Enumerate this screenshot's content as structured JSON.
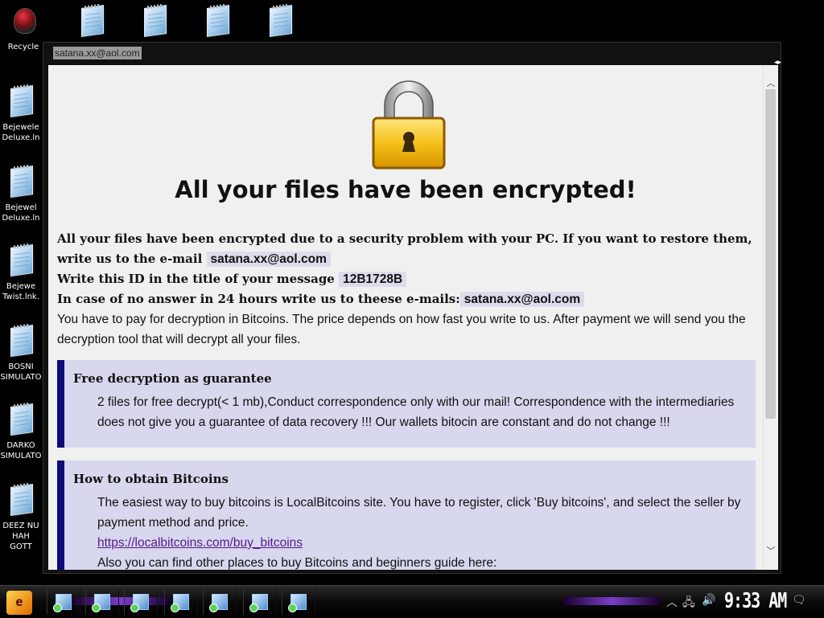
{
  "desktop": {
    "icons": [
      {
        "label": "Recycle",
        "icon": "recycle-bin-icon"
      },
      {
        "label": "",
        "icon": "notepad-icon"
      },
      {
        "label": "",
        "icon": "notepad-icon"
      },
      {
        "label": "",
        "icon": "notepad-icon"
      },
      {
        "label": "",
        "icon": "notepad-icon"
      },
      {
        "label": "Bejewele Deluxe.ln",
        "icon": "notepad-icon"
      },
      {
        "label": "Bejewel Deluxe.ln",
        "icon": "notepad-icon"
      },
      {
        "label": "Bejewe Twist.lnk.",
        "icon": "notepad-icon"
      },
      {
        "label": "BOSNI SIMULATO",
        "icon": "notepad-icon"
      },
      {
        "label": "DARKO SIMULATO",
        "icon": "notepad-icon"
      },
      {
        "label": "DEEZ NU HAH GOTT",
        "icon": "notepad-icon"
      }
    ]
  },
  "window": {
    "title": "satana.xx@aol.com",
    "headline": "All your files have been encrypted!",
    "line1_text": "All your files have been encrypted due to a security problem with your PC. If you want to restore them, write us to the e-mail",
    "email": "satana.xx@aol.com",
    "line2_text": "Write this ID in the title of your message",
    "id_code": "12B1728B",
    "line3_text": "In case of no answer in 24 hours write us to theese e-mails:",
    "email2": "satana.xx@aol.com",
    "pay_text": "You have to pay for decryption in Bitcoins. The price depends on how fast you write to us. After payment we will send you the decryption tool that will decrypt all your files.",
    "box1": {
      "title": "Free decryption as guarantee",
      "body": "2 files for free decrypt(< 1 mb),Conduct correspondence only with our mail! Correspondence with the intermediaries does not give you a guarantee of data recovery !!! Our wallets bitocin are constant and do not change !!!"
    },
    "box2": {
      "title": "How to obtain Bitcoins",
      "body": "The easiest way to buy bitcoins is LocalBitcoins site. You have to register, click 'Buy bitcoins', and select the seller by payment method and price.",
      "link": "https://localbitcoins.com/buy_bitcoins",
      "body2": "Also you can find other places to buy Bitcoins and beginners guide here:"
    }
  },
  "taskbar": {
    "start_icon": "start-orb-icon",
    "clock": "9:33 AM",
    "tray_icons": [
      "up-arrow-icon",
      "network-icon",
      "volume-icon",
      "action-center-icon"
    ]
  },
  "colors": {
    "box_bg": "#d7d7ee",
    "box_border": "#0b0b7a",
    "highlight": "#dcdcec",
    "link": "#551a8b"
  }
}
